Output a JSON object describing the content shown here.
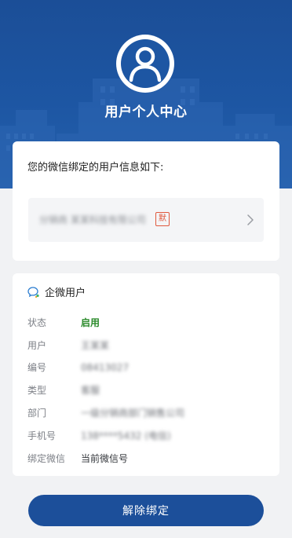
{
  "header": {
    "title": "用户个人中心",
    "icon": "user-avatar-icon",
    "background": "#1d56a3"
  },
  "account_card": {
    "prompt": "您的微信绑定的用户信息如下:",
    "account_name": "分销商 某某科技有限公司",
    "tag": "默",
    "chevron_icon": "chevron-right-icon"
  },
  "detail_card": {
    "title": "企微用户",
    "icon": "wecom-chat-icon",
    "rows": [
      {
        "label": "状态",
        "value": "启用",
        "style": "green"
      },
      {
        "label": "用户",
        "value": "王某某",
        "style": "blur"
      },
      {
        "label": "编号",
        "value": "08413027",
        "style": "blur"
      },
      {
        "label": "类型",
        "value": "客服",
        "style": "blur"
      },
      {
        "label": "部门",
        "value": "一级分销商部门销售公司",
        "style": "blur"
      },
      {
        "label": "手机号",
        "value": "138****5432 (电信)",
        "style": "blur"
      },
      {
        "label": "绑定微信",
        "value": "当前微信号",
        "style": "plain"
      }
    ]
  },
  "unbind_button": {
    "label": "解除绑定",
    "color": "#1c4f9a"
  }
}
